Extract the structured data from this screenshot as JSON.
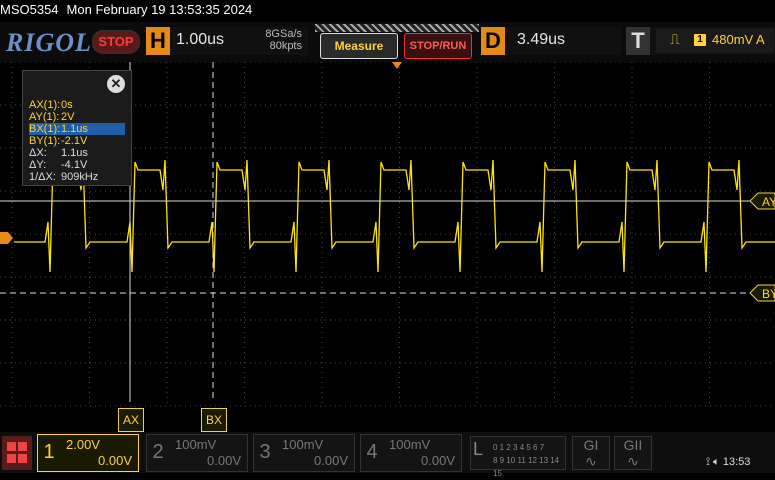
{
  "titlebar": {
    "model": "MSO5354",
    "datetime": "Mon February 19 13:53:35 2024"
  },
  "toolbar": {
    "logo": "RIGOL",
    "run_state": "STOP",
    "horizontal": {
      "letter": "H",
      "timebase": "1.00us",
      "sample_rate": "8GSa/s",
      "memory": "80kpts"
    },
    "measure_label": "Measure",
    "stop_run_label": "STOP/RUN",
    "delay": {
      "letter": "D",
      "value": "3.49us"
    },
    "trigger": {
      "letter": "T",
      "channel": "1",
      "level": "480mV",
      "mode": "A"
    }
  },
  "measure_panel": {
    "close_icon": "close-icon",
    "rows": [
      {
        "key": "AX(1):",
        "value": "0s",
        "selected": false
      },
      {
        "key": "AY(1):",
        "value": "2V",
        "selected": false
      },
      {
        "key": "BX(1):",
        "value": "1.1us",
        "selected": true
      },
      {
        "key": "BY(1):",
        "value": "-2.1V",
        "selected": false
      },
      {
        "key": "ΔX:",
        "value": "1.1us",
        "selected": false
      },
      {
        "key": "ΔY:",
        "value": "-4.1V",
        "selected": false
      },
      {
        "key": "1/ΔX:",
        "value": "909kHz",
        "selected": false
      }
    ]
  },
  "cursors": {
    "ax": "AX",
    "bx": "BX",
    "ay": "AY",
    "by": "BY"
  },
  "channels": [
    {
      "num": "1",
      "scale": "2.00V",
      "offset": "0.00V",
      "active": true
    },
    {
      "num": "2",
      "scale": "100mV",
      "offset": "0.00V",
      "active": false
    },
    {
      "num": "3",
      "scale": "100mV",
      "offset": "0.00V",
      "active": false
    },
    {
      "num": "4",
      "scale": "100mV",
      "offset": "0.00V",
      "active": false
    }
  ],
  "logic": {
    "letter": "L",
    "row1": "0 1 2 3  4 5 6 7",
    "row2": "8 9 10 11 12 13 14 15"
  },
  "gen": {
    "g1": "GI",
    "g2": "GII"
  },
  "status": {
    "time": "13:53"
  },
  "colors": {
    "trace": "#ffe600",
    "accent": "#e58a18",
    "grid": "#4a4a4a"
  }
}
